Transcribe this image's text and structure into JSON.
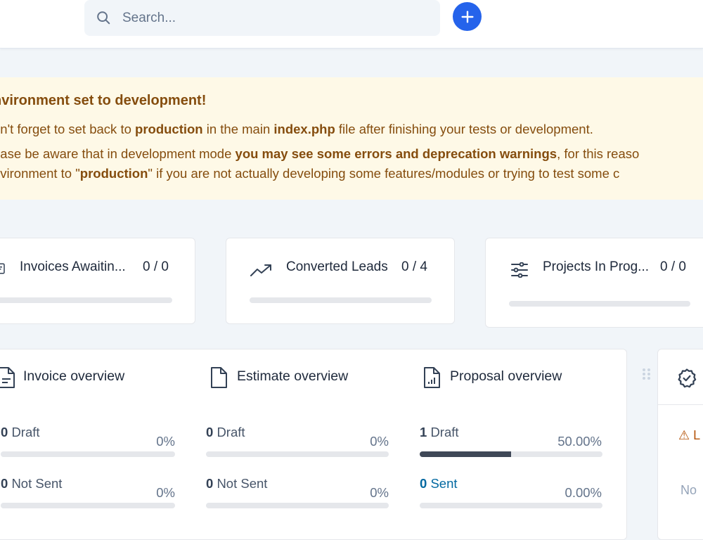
{
  "search": {
    "placeholder": "Search..."
  },
  "alert": {
    "title": "nvironment set to development!",
    "line1_a": "on't forget to set back to ",
    "line1_b": "production",
    "line1_c": " in the main ",
    "line1_d": "index.php",
    "line1_e": " file after finishing your tests or development.",
    "line2_a": "ease be aware that in development mode ",
    "line2_b": "you may see some errors and deprecation warnings",
    "line2_c": ", for this reaso",
    "line3_a": "nvironment to \"",
    "line3_b": "production",
    "line3_c": "\" if you are not actually developing some features/modules or trying to test some c"
  },
  "stats": [
    {
      "label": "Invoices Awaitin...",
      "value": "0 / 0",
      "progress": 0,
      "icon": "invoice-icon"
    },
    {
      "label": "Converted Leads",
      "value": "0 / 4",
      "progress": 0,
      "icon": "trending-up-icon"
    },
    {
      "label": "Projects In Prog...",
      "value": "0 / 0",
      "progress": 0,
      "icon": "sliders-icon"
    }
  ],
  "overview": {
    "invoice": {
      "title": "Invoice overview",
      "rows": [
        {
          "count": "0",
          "label": "Draft",
          "pct": "0%",
          "progress": 0
        },
        {
          "count": "0",
          "label": "Not Sent",
          "pct": "0%",
          "progress": 0
        }
      ]
    },
    "estimate": {
      "title": "Estimate overview",
      "rows": [
        {
          "count": "0",
          "label": "Draft",
          "pct": "0%",
          "progress": 0
        },
        {
          "count": "0",
          "label": "Not Sent",
          "pct": "0%",
          "progress": 0
        }
      ]
    },
    "proposal": {
      "title": "Proposal overview",
      "rows": [
        {
          "count": "1",
          "label": "Draft",
          "pct": "50.00%",
          "progress": 0.5
        },
        {
          "count": "0",
          "label": "Sent",
          "pct": "0.00%",
          "progress": 0
        }
      ]
    }
  },
  "right_card": {
    "warning": "L",
    "no_text": "No"
  },
  "colors": {
    "accent": "#2563eb",
    "alert_bg": "#fef9e7",
    "alert_text": "#854d0e",
    "link": "#0369a1",
    "bar_fill": "#3f4857"
  }
}
